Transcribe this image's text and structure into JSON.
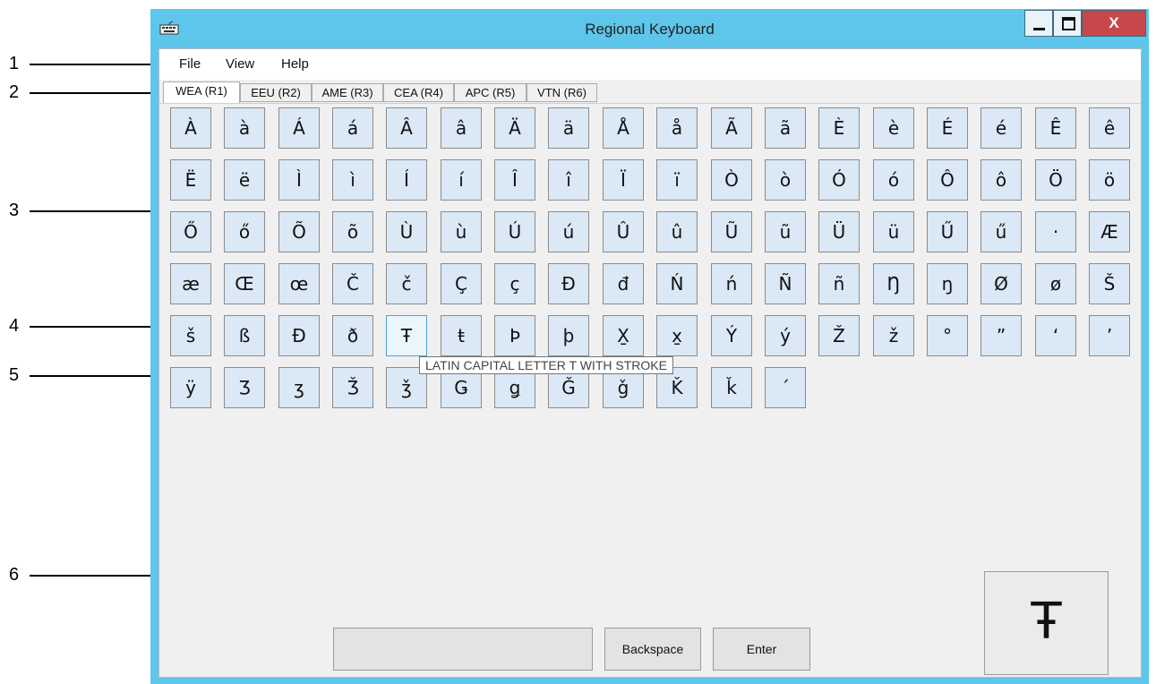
{
  "window": {
    "title": "Regional Keyboard",
    "close_label": "X"
  },
  "menu": [
    "File",
    "View",
    "Help"
  ],
  "tabs": [
    "WEA (R1)",
    "EEU (R2)",
    "AME (R3)",
    "CEA (R4)",
    "APC (R5)",
    "VTN (R6)"
  ],
  "active_tab": "WEA (R1)",
  "keys": [
    [
      "À",
      "à",
      "Á",
      "á",
      "Â",
      "â",
      "Ä",
      "ä",
      "Å",
      "å",
      "Ã",
      "ã",
      "È",
      "è",
      "É",
      "é",
      "Ê",
      "ê"
    ],
    [
      "Ë",
      "ë",
      "Ì",
      "ì",
      "Í",
      "í",
      "Î",
      "î",
      "Ï",
      "ï",
      "Ò",
      "ò",
      "Ó",
      "ó",
      "Ô",
      "ô",
      "Ö",
      "ö"
    ],
    [
      "Ő",
      "ő",
      "Õ",
      "õ",
      "Ù",
      "ù",
      "Ú",
      "ú",
      "Û",
      "û",
      "Ũ",
      "ũ",
      "Ü",
      "ü",
      "Ű",
      "ű",
      "·",
      "Æ"
    ],
    [
      "æ",
      "Œ",
      "œ",
      "Č",
      "č",
      "Ç",
      "ç",
      "Đ",
      "đ",
      "Ń",
      "ń",
      "Ñ",
      "ñ",
      "Ŋ",
      "ŋ",
      "Ø",
      "ø",
      "Š"
    ],
    [
      "š",
      "ß",
      "Ð",
      "ð",
      "Ŧ",
      "ŧ",
      "Þ",
      "þ",
      "X̱",
      "x̱",
      "Ý",
      "ý",
      "Ž",
      "ž",
      "°",
      "”",
      "‘",
      "’"
    ],
    [
      "ÿ",
      "Ʒ",
      "ʒ",
      "Ǯ",
      "ǯ",
      "Ǥ",
      "ǥ",
      "Ǧ",
      "ǧ",
      "Ǩ",
      "ǩ",
      "´"
    ]
  ],
  "hovered_key": "Ŧ",
  "tooltip": "LATIN CAPITAL LETTER T WITH STROKE",
  "buttons": {
    "backspace": "Backspace",
    "enter": "Enter"
  },
  "preview_char": "Ŧ",
  "callouts": [
    "1",
    "2",
    "3",
    "4",
    "5",
    "6"
  ],
  "colors": {
    "window_frame": "#5ec6ea",
    "close_button": "#c8474a",
    "key_fill": "#dbe8f5"
  }
}
